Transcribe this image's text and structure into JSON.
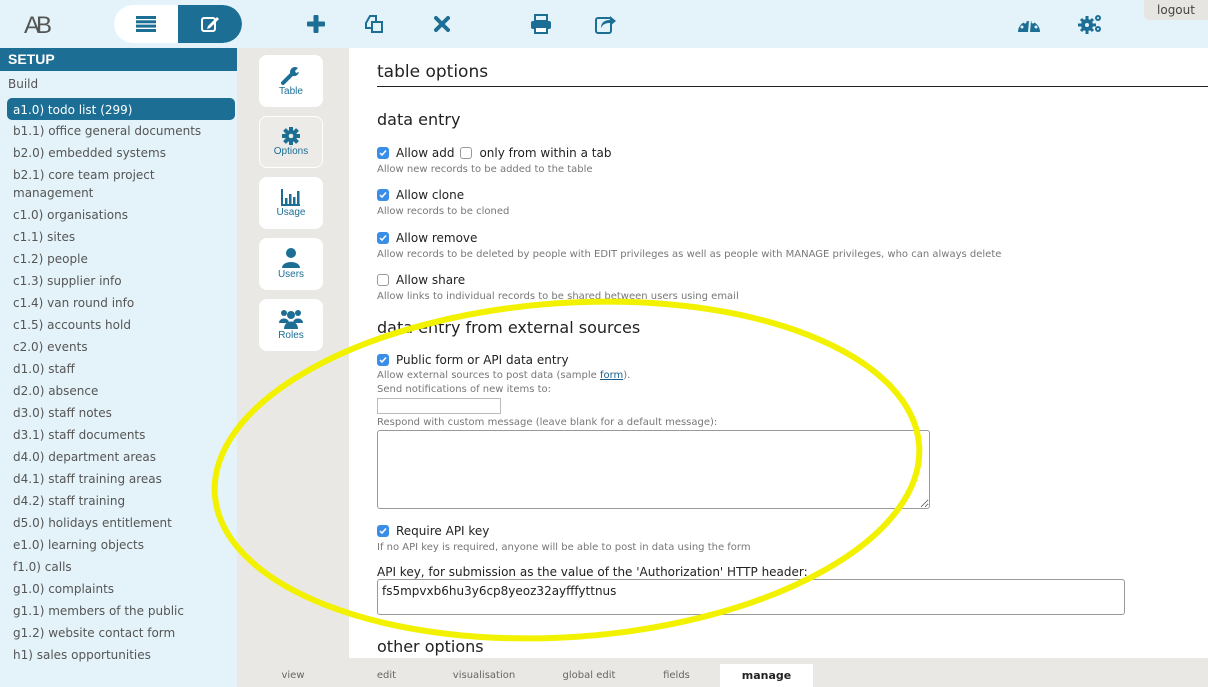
{
  "topbar": {
    "logo": "AB",
    "toggle": [
      {
        "icon": "list-icon",
        "active": false
      },
      {
        "icon": "edit-icon",
        "active": true
      }
    ],
    "actions": [
      {
        "icon": "plus-icon",
        "label": "add"
      },
      {
        "icon": "copy-icon",
        "label": "clone"
      },
      {
        "icon": "close-icon",
        "label": "remove"
      },
      {
        "icon": "print-icon",
        "label": "print"
      },
      {
        "icon": "share-icon",
        "label": "share"
      }
    ],
    "right_icons": [
      {
        "icon": "dashboard-icon"
      },
      {
        "icon": "gears-icon"
      }
    ],
    "logout": "logout"
  },
  "sidebar": {
    "header": "SETUP",
    "section": "Build",
    "items": [
      {
        "label": "a1.0) todo list (299)",
        "active": true
      },
      {
        "label": "b1.1) office general documents"
      },
      {
        "label": "b2.0) embedded systems"
      },
      {
        "label": "b2.1) core team project management"
      },
      {
        "label": "c1.0) organisations"
      },
      {
        "label": "c1.1) sites"
      },
      {
        "label": "c1.2) people"
      },
      {
        "label": "c1.3) supplier info"
      },
      {
        "label": "c1.4) van round info"
      },
      {
        "label": "c1.5) accounts hold"
      },
      {
        "label": "c2.0) events"
      },
      {
        "label": "d1.0) staff"
      },
      {
        "label": "d2.0) absence"
      },
      {
        "label": "d3.0) staff notes"
      },
      {
        "label": "d3.1) staff documents"
      },
      {
        "label": "d4.0) department areas"
      },
      {
        "label": "d4.1) staff training areas"
      },
      {
        "label": "d4.2) staff training"
      },
      {
        "label": "d5.0) holidays entitlement"
      },
      {
        "label": "e1.0) learning objects"
      },
      {
        "label": "f1.0) calls"
      },
      {
        "label": "g1.0) complaints"
      },
      {
        "label": "g1.1) members of the public"
      },
      {
        "label": "g1.2) website contact form"
      },
      {
        "label": "h1) sales opportunities"
      }
    ]
  },
  "iconcol": {
    "buttons": [
      {
        "label": "Table",
        "icon": "wrench-icon"
      },
      {
        "label": "Options",
        "icon": "gear-icon",
        "selected": true
      },
      {
        "label": "Usage",
        "icon": "bar-chart-icon"
      },
      {
        "label": "Users",
        "icon": "user-icon"
      },
      {
        "label": "Roles",
        "icon": "users-group-icon"
      }
    ]
  },
  "main": {
    "title": "table options",
    "data_entry": {
      "heading": "data entry",
      "allow_add": {
        "label": "Allow add",
        "checked": true
      },
      "only_tab": {
        "label": "only from within a tab",
        "checked": false
      },
      "allow_add_desc": "Allow new records to be added to the table",
      "allow_clone": {
        "label": "Allow clone",
        "checked": true
      },
      "allow_clone_desc": "Allow records to be cloned",
      "allow_remove": {
        "label": "Allow remove",
        "checked": true
      },
      "allow_remove_desc": "Allow records to be deleted by people with EDIT privileges as well as people with MANAGE privileges, who can always delete",
      "allow_share": {
        "label": "Allow share",
        "checked": false
      },
      "allow_share_desc": "Allow links to individual records to be shared between users using email"
    },
    "external": {
      "heading": "data entry from external sources",
      "public_form": {
        "label": "Public form or API data entry",
        "checked": true
      },
      "public_desc_pre": "Allow external sources to post data (sample ",
      "public_desc_link": "form",
      "public_desc_post": ").",
      "notify_label": "Send notifications of new items to:",
      "notify_value": "",
      "message_label": "Respond with custom message (leave blank for a default message):",
      "message_value": "",
      "require_key": {
        "label": "Require API key",
        "checked": true
      },
      "require_key_desc": "If no API key is required, anyone will be able to post in data using the form",
      "api_key_label": "API key, for submission as the value of the 'Authorization' HTTP header:",
      "api_key_value": "fs5mpvxb6hu3y6cp8yeoz32ayfffyttnus"
    },
    "other": {
      "heading": "other options"
    }
  },
  "tabs": [
    {
      "label": "view"
    },
    {
      "label": "edit"
    },
    {
      "label": "visualisation"
    },
    {
      "label": "global edit"
    },
    {
      "label": "fields"
    },
    {
      "label": "manage",
      "active": true
    }
  ],
  "colors": {
    "brand": "#1c6e95",
    "checkbox": "#3b8ee8",
    "annotation": "#f2f200"
  }
}
